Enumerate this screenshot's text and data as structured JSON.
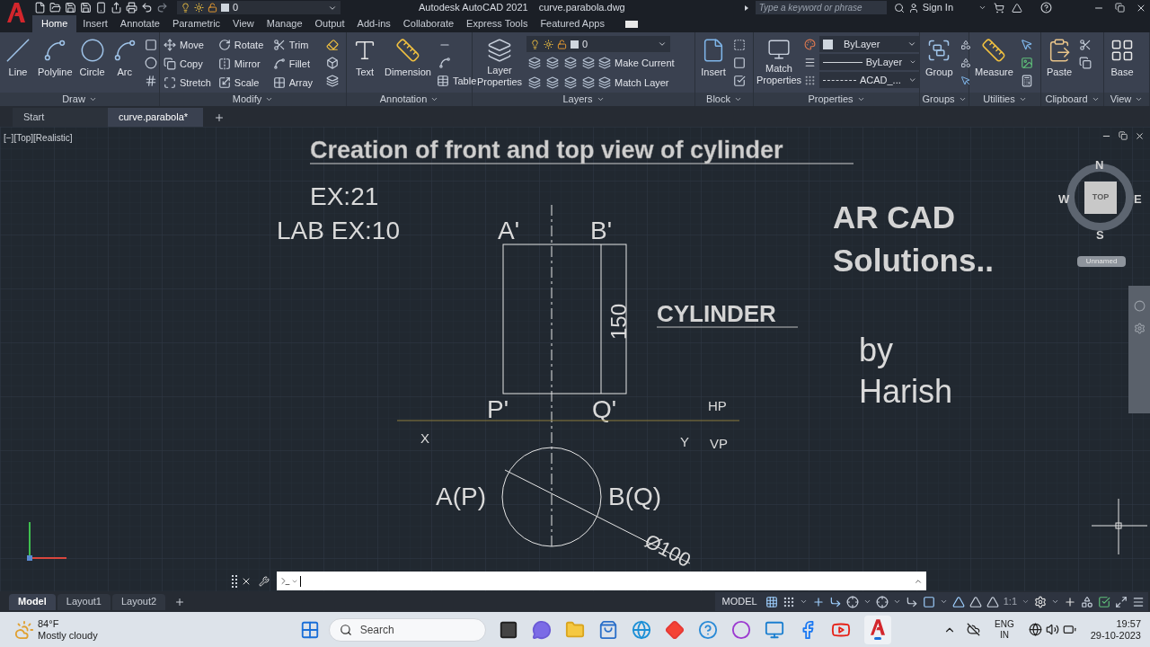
{
  "title_bar": {
    "layer": "0",
    "app_title": "Autodesk AutoCAD 2021",
    "file_name": "curve.parabola.dwg",
    "search": {
      "placeholder": "Type a keyword or phrase"
    },
    "sign_in": "Sign In"
  },
  "ribbon_tabs": [
    {
      "label": "Home",
      "selected": true
    },
    {
      "label": "Insert",
      "selected": false
    },
    {
      "label": "Annotate",
      "selected": false
    },
    {
      "label": "Parametric",
      "selected": false
    },
    {
      "label": "View",
      "selected": false
    },
    {
      "label": "Manage",
      "selected": false
    },
    {
      "label": "Output",
      "selected": false
    },
    {
      "label": "Add-ins",
      "selected": false
    },
    {
      "label": "Collaborate",
      "selected": false
    },
    {
      "label": "Express Tools",
      "selected": false
    },
    {
      "label": "Featured Apps",
      "selected": false
    }
  ],
  "ribbon": {
    "draw": {
      "title": "Draw",
      "tools": [
        "Line",
        "Polyline",
        "Circle",
        "Arc"
      ]
    },
    "modify": {
      "title": "Modify",
      "tools": [
        "Move",
        "Rotate",
        "Trim",
        "Copy",
        "Mirror",
        "Fillet",
        "Stretch",
        "Scale",
        "Array"
      ]
    },
    "annotation": {
      "title": "Annotation",
      "tools": [
        "Text",
        "Dimension",
        "Table"
      ]
    },
    "layers": {
      "title": "Layers",
      "properties": "Layer Properties",
      "current_layer": "0",
      "tools": [
        "Make Current",
        "Match Layer"
      ]
    },
    "block": {
      "title": "Block",
      "tool": "Insert"
    },
    "properties": {
      "title": "Properties",
      "match": "Match Properties",
      "color_setting": "ByLayer",
      "lineweight": "ByLayer",
      "linetype": "ACAD_..."
    },
    "groups": {
      "title": "Groups",
      "tool": "Group"
    },
    "utilities": {
      "title": "Utilities",
      "tool": "Measure"
    },
    "clipboard": {
      "title": "Clipboard",
      "tool": "Paste"
    },
    "view": {
      "title": "View",
      "tool": "Base"
    }
  },
  "file_tabs": [
    {
      "label": "Start",
      "selected": false
    },
    {
      "label": "curve.parabola*",
      "selected": true
    }
  ],
  "viewport_label": "[−][Top][Realistic]",
  "drawing": {
    "title": "Creation of front and top view of cylinder",
    "exercise": "EX:21",
    "lab_exercise": "LAB EX:10",
    "front_labels": [
      "A'",
      "B'",
      "P'",
      "Q'"
    ],
    "height_dimension": "150",
    "object_name": "CYLINDER",
    "company": [
      "AR CAD",
      "Solutions.."
    ],
    "by": "by",
    "author": "Harish",
    "plane_labels": [
      "HP",
      "VP"
    ],
    "axis_labels": [
      "X",
      "Y"
    ],
    "top_labels": [
      "A(P)",
      "B(Q)"
    ],
    "diameter_dimension": "Ø100"
  },
  "viewcube": {
    "north": "N",
    "south": "S",
    "east": "E",
    "west": "W",
    "face": "TOP",
    "view_name": "Unnamed"
  },
  "layout_tabs": [
    {
      "label": "Model",
      "selected": true
    },
    {
      "label": "Layout1",
      "selected": false
    },
    {
      "label": "Layout2",
      "selected": false
    }
  ],
  "status_bar": {
    "space": "MODEL",
    "scale": "1:1"
  },
  "taskbar": {
    "temperature": "84°F",
    "condition": "Mostly cloudy",
    "search": {
      "placeholder": "Search"
    },
    "language": [
      "ENG",
      "IN"
    ],
    "time": "19:57",
    "date": "29-10-2023"
  }
}
